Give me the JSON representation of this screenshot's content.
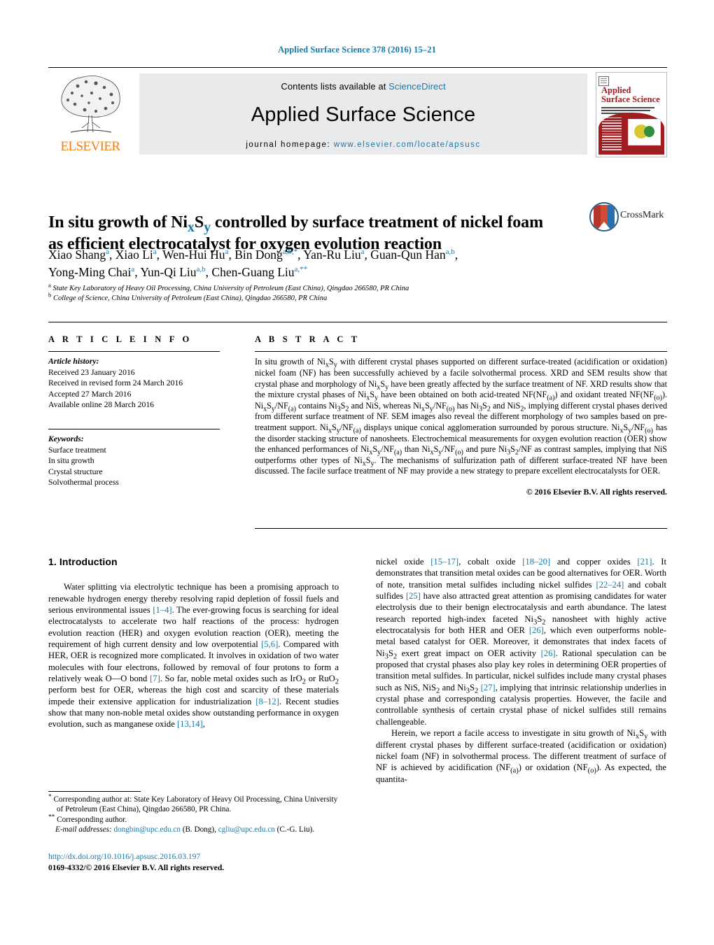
{
  "running_head": "Applied Surface Science 378 (2016) 15–21",
  "masthead": {
    "publisher": "ELSEVIER",
    "contents_prefix": "Contents lists available at ",
    "contents_link": "ScienceDirect",
    "journal_name": "Applied Surface Science",
    "homepage_prefix": "journal homepage: ",
    "homepage_url": "www.elsevier.com/locate/apsusc",
    "cover_title_line1": "Applied",
    "cover_title_line2": "Surface Science"
  },
  "article": {
    "title_line1_a": "In situ growth of Ni",
    "title_sub_x": "x",
    "title_line1_b": "S",
    "title_sub_y": "y",
    "title_line1_c": " controlled by surface treatment of nickel foam",
    "title_line2": "as efficient electrocatalyst for oxygen evolution reaction",
    "crossmark_label": "CrossMark",
    "authors_line1": "Xiao Shang a , Xiao Li a , Wen-Hui Hu a , Bin Dong a,b,* , Yan-Ru Liu a , Guan-Qun Han a,b ,",
    "authors_line2": "Yong-Ming Chai a , Yun-Qi Liu a,b , Chen-Guang Liu a,**",
    "affiliation_a": "State Key Laboratory of Heavy Oil Processing, China University of Petroleum (East China), Qingdao 266580, PR China",
    "affiliation_b": "College of Science, China University of Petroleum (East China), Qingdao 266580, PR China"
  },
  "article_info": {
    "heading": "A R T I C L E    I N F O",
    "history_label": "Article history:",
    "history": [
      "Received 23 January 2016",
      "Received in revised form 24 March 2016",
      "Accepted 27 March 2016",
      "Available online 28 March 2016"
    ],
    "keywords_label": "Keywords:",
    "keywords": [
      "Surface treatment",
      "In situ growth",
      "Crystal structure",
      "Solvothermal process"
    ]
  },
  "abstract": {
    "heading": "A B S T R A C T",
    "copyright": "© 2016 Elsevier B.V. All rights reserved."
  },
  "intro": {
    "heading": "1.  Introduction",
    "left_para": "Water splitting via electrolytic technique has been a promising approach to renewable hydrogen energy thereby resolving rapid depletion of fossil fuels and serious environmental issues [1–4]. The ever-growing focus is searching for ideal electrocatalysts to accelerate two half reactions of the process: hydrogen evolution reaction (HER) and oxygen evolution reaction (OER), meeting the requirement of high current density and low overpotential [5,6]. Compared with HER, OER is recognized more complicated. It involves in oxidation of two water molecules with four electrons, followed by removal of four protons to form a relatively weak O—O bond [7]. So far, noble metal oxides such as IrO2 or RuO2 perform best for OER, whereas the high cost and scarcity of these materials impede their extensive application for industrialization [8–12]. Recent studies show that many non-noble metal oxides show outstanding performance in oxygen evolution, such as manganese oxide [13,14],"
  },
  "footnotes": {
    "star_label": "*",
    "star_text": " Corresponding author at: State Key Laboratory of Heavy Oil Processing, China University of Petroleum (East China), Qingdao 266580, PR China.",
    "dstar_label": "**",
    "dstar_text": " Corresponding author.",
    "email_label": "E-mail addresses:",
    "email1": "dongbin@upc.edu.cn",
    "email1_owner": " (B. Dong), ",
    "email2": "cgliu@upc.edu.cn",
    "email2_owner": " (C.-G. Liu).",
    "doi": "http://dx.doi.org/10.1016/j.apsusc.2016.03.197",
    "issn_prefix": "0169-4332/",
    "issn_rights": "© 2016 Elsevier B.V. All rights reserved."
  },
  "colors": {
    "link": "#1878a8",
    "elsevier_orange": "#f07f12",
    "band_gray": "#e9eaec",
    "cover_red": "#9f1d20"
  }
}
